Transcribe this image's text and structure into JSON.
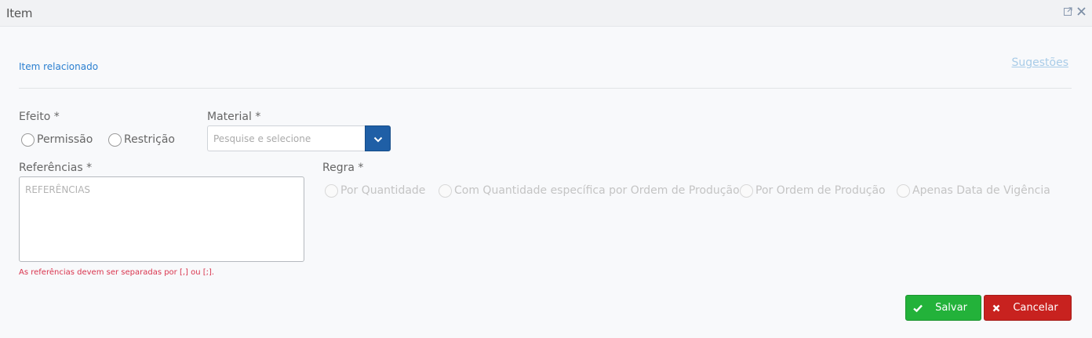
{
  "window": {
    "title": "Item",
    "controls": [
      "popout-icon",
      "close-icon"
    ]
  },
  "section": {
    "title": "Item relacionado",
    "suggestions_link": "Sugestões"
  },
  "efeito": {
    "label": "Efeito  *",
    "options": [
      "Permissão",
      "Restrição"
    ],
    "selected": null
  },
  "material": {
    "label": "Material  *",
    "placeholder": "Pesquise e selecione"
  },
  "referencias": {
    "label": "Referências  *",
    "placeholder": "REFERÊNCIAS",
    "hint": "As referências devem ser separadas por [,] ou [;]."
  },
  "regra": {
    "label": "Regra  *",
    "options": [
      "Por Quantidade",
      "Com Quantidade específica por Ordem de Produção",
      "Por Ordem de Produção",
      "Apenas Data de Vigência"
    ],
    "disabled": true
  },
  "actions": {
    "save_label": "Salvar",
    "cancel_label": "Cancelar"
  },
  "colors": {
    "accent_blue": "#1f5fa6",
    "link_blue": "#2a7fd0",
    "save_green": "#23b23a",
    "cancel_red": "#c8221f",
    "hint_red": "#d9344d"
  }
}
